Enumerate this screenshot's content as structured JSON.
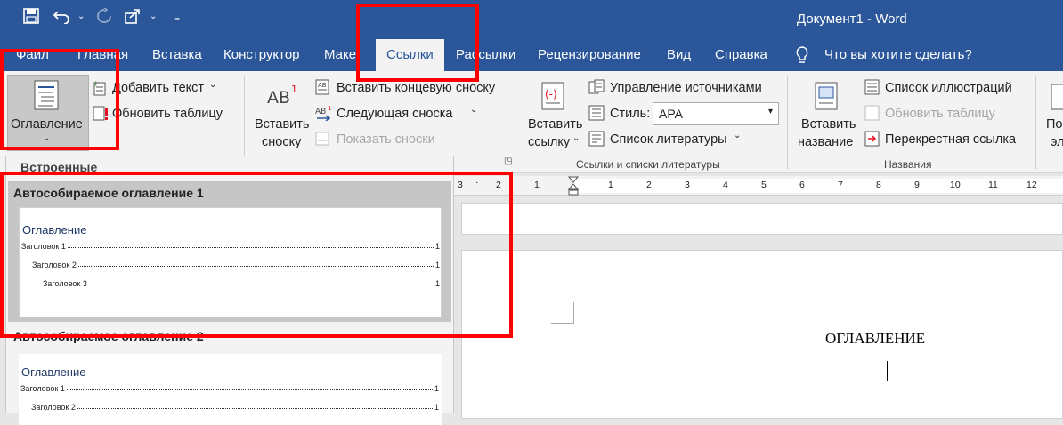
{
  "window": {
    "title": "Документ1  -  Word"
  },
  "qat": {
    "save_icon": "save-icon",
    "undo_icon": "undo-icon",
    "redo_icon": "redo-icon",
    "share_icon": "share-icon",
    "customize_icon": "customize-icon"
  },
  "tabs": {
    "file": "Файл",
    "home": "Главная",
    "insert": "Вставка",
    "design": "Конструктор",
    "layout": "Макет",
    "references": "Ссылки",
    "mailings": "Рассылки",
    "review": "Рецензирование",
    "view": "Вид",
    "help": "Справка",
    "tell_me": "Что вы хотите сделать?"
  },
  "ribbon": {
    "toc": {
      "label": "Оглавление",
      "add_text": "Добавить текст",
      "update_table": "Обновить таблицу"
    },
    "footnotes": {
      "insert_footnote_1": "Вставить",
      "insert_footnote_2": "сноску",
      "insert_endnote": "Вставить концевую сноску",
      "next_footnote": "Следующая сноска",
      "show_notes": "Показать сноски"
    },
    "citations": {
      "insert_citation_1": "Вставить",
      "insert_citation_2": "ссылку",
      "manage_sources": "Управление источниками",
      "style_label": "Стиль:",
      "style_value": "APA",
      "bibliography": "Список литературы",
      "group_label": "Ссылки и списки литературы"
    },
    "captions": {
      "insert_caption_1": "Вставить",
      "insert_caption_2": "название",
      "table_of_figures": "Список иллюстраций",
      "update_table": "Обновить таблицу",
      "cross_reference": "Перекрестная ссылка",
      "group_label": "Названия"
    },
    "index": {
      "label_1": "По",
      "label_2": "эл"
    }
  },
  "dropdown": {
    "header": "Встроенные",
    "items": [
      {
        "title": "Автособираемое оглавление 1",
        "preview_title": "Оглавление",
        "entries": [
          {
            "text": "Заголовок 1",
            "page": "1"
          },
          {
            "text": "Заголовок 2",
            "page": "1"
          },
          {
            "text": "Заголовок 3",
            "page": "1"
          }
        ]
      },
      {
        "title": "Автособираемое оглавление 2",
        "preview_title": "Оглавление",
        "entries": [
          {
            "text": "Заголовок 1",
            "page": "1"
          },
          {
            "text": "Заголовок 2",
            "page": "1"
          }
        ]
      }
    ]
  },
  "ruler": {
    "numbers": [
      "3",
      "2",
      "1",
      "1",
      "2",
      "3",
      "4",
      "5",
      "6",
      "7",
      "8",
      "9",
      "10",
      "11",
      "12"
    ]
  },
  "document": {
    "heading": "ОГЛАВЛЕНИЕ"
  }
}
